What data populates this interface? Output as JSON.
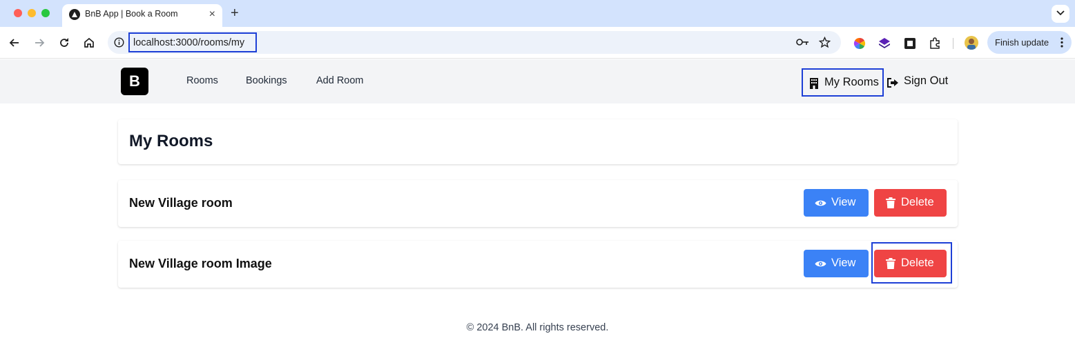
{
  "browser": {
    "tab_title": "BnB App | Book a Room",
    "url": "localhost:3000/rooms/my",
    "update_label": "Finish update"
  },
  "nav": {
    "logo_letter": "B",
    "links": [
      "Rooms",
      "Bookings",
      "Add Room"
    ],
    "my_rooms": "My Rooms",
    "sign_out": "Sign Out"
  },
  "page": {
    "title": "My Rooms",
    "rooms": [
      {
        "name": "New Village room",
        "view_label": "View",
        "delete_label": "Delete"
      },
      {
        "name": "New Village room Image",
        "view_label": "View",
        "delete_label": "Delete"
      }
    ]
  },
  "footer": {
    "text": "© 2024 BnB. All rights reserved."
  },
  "colors": {
    "view": "#3b82f6",
    "delete": "#ef4444",
    "highlight": "#1d3fd6",
    "nav_bg": "#f3f4f6"
  }
}
